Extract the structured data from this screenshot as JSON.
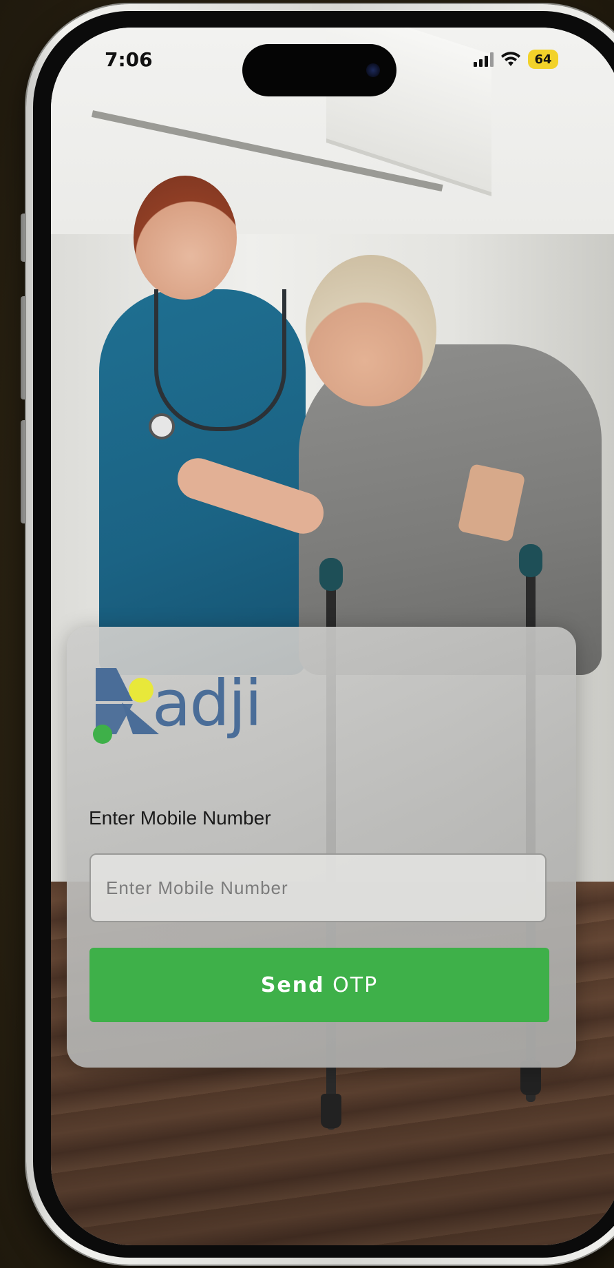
{
  "status_bar": {
    "time": "7:06",
    "battery_level": "64",
    "battery_color": "#f2d22a",
    "icons": [
      "signal-icon",
      "wifi-icon"
    ]
  },
  "brand": {
    "name": "kadji",
    "wordmark": "adji",
    "colors": {
      "primary": "#4a6d98",
      "accent_yellow": "#e8e83a",
      "accent_green": "#3eb049"
    }
  },
  "login": {
    "field_label": "Enter Mobile Number",
    "input_placeholder": "Enter Mobile Number",
    "input_value": "",
    "button_bold": "Send",
    "button_rest": " OTP",
    "button_color": "#3eb049"
  }
}
